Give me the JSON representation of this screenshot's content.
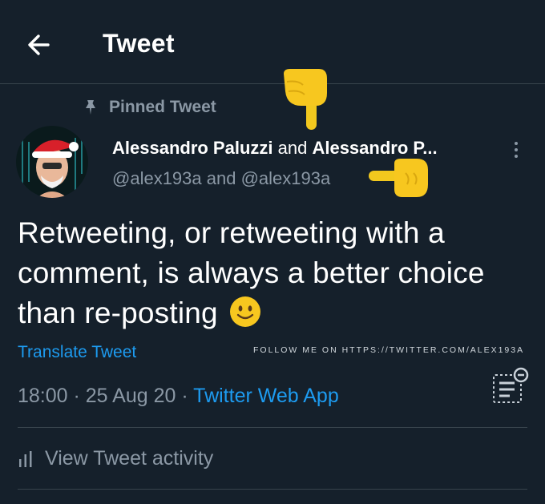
{
  "header": {
    "title": "Tweet"
  },
  "pinned": {
    "label": "Pinned Tweet"
  },
  "author": {
    "name1": "Alessandro Paluzzi",
    "joiner": " and ",
    "name2": "Alessandro P...",
    "handle1": "@alex193a",
    "handle_joiner": " and ",
    "handle2": "@alex193a"
  },
  "tweet": {
    "text": "Retweeting, or retweeting with a comment, is always a better choice than re-posting"
  },
  "translate_label": "Translate Tweet",
  "watermark": "FOLLOW ME ON HTTPS://TWITTER.COM/ALEX193A",
  "meta": {
    "time": "18:00",
    "sep1": " · ",
    "date": "25 Aug 20",
    "sep2": " · ",
    "source": "Twitter Web App"
  },
  "activity_label": "View Tweet activity",
  "colors": {
    "background": "#15202b",
    "accent": "#1d9bf0",
    "secondary_text": "#8b98a5",
    "divider": "#38444d"
  },
  "icons": [
    "back-arrow-icon",
    "pin-icon",
    "more-icon",
    "smile-emoji-icon",
    "hand-pointing-down-icon",
    "hand-pointing-left-icon",
    "notes-icon",
    "activity-bars-icon"
  ]
}
